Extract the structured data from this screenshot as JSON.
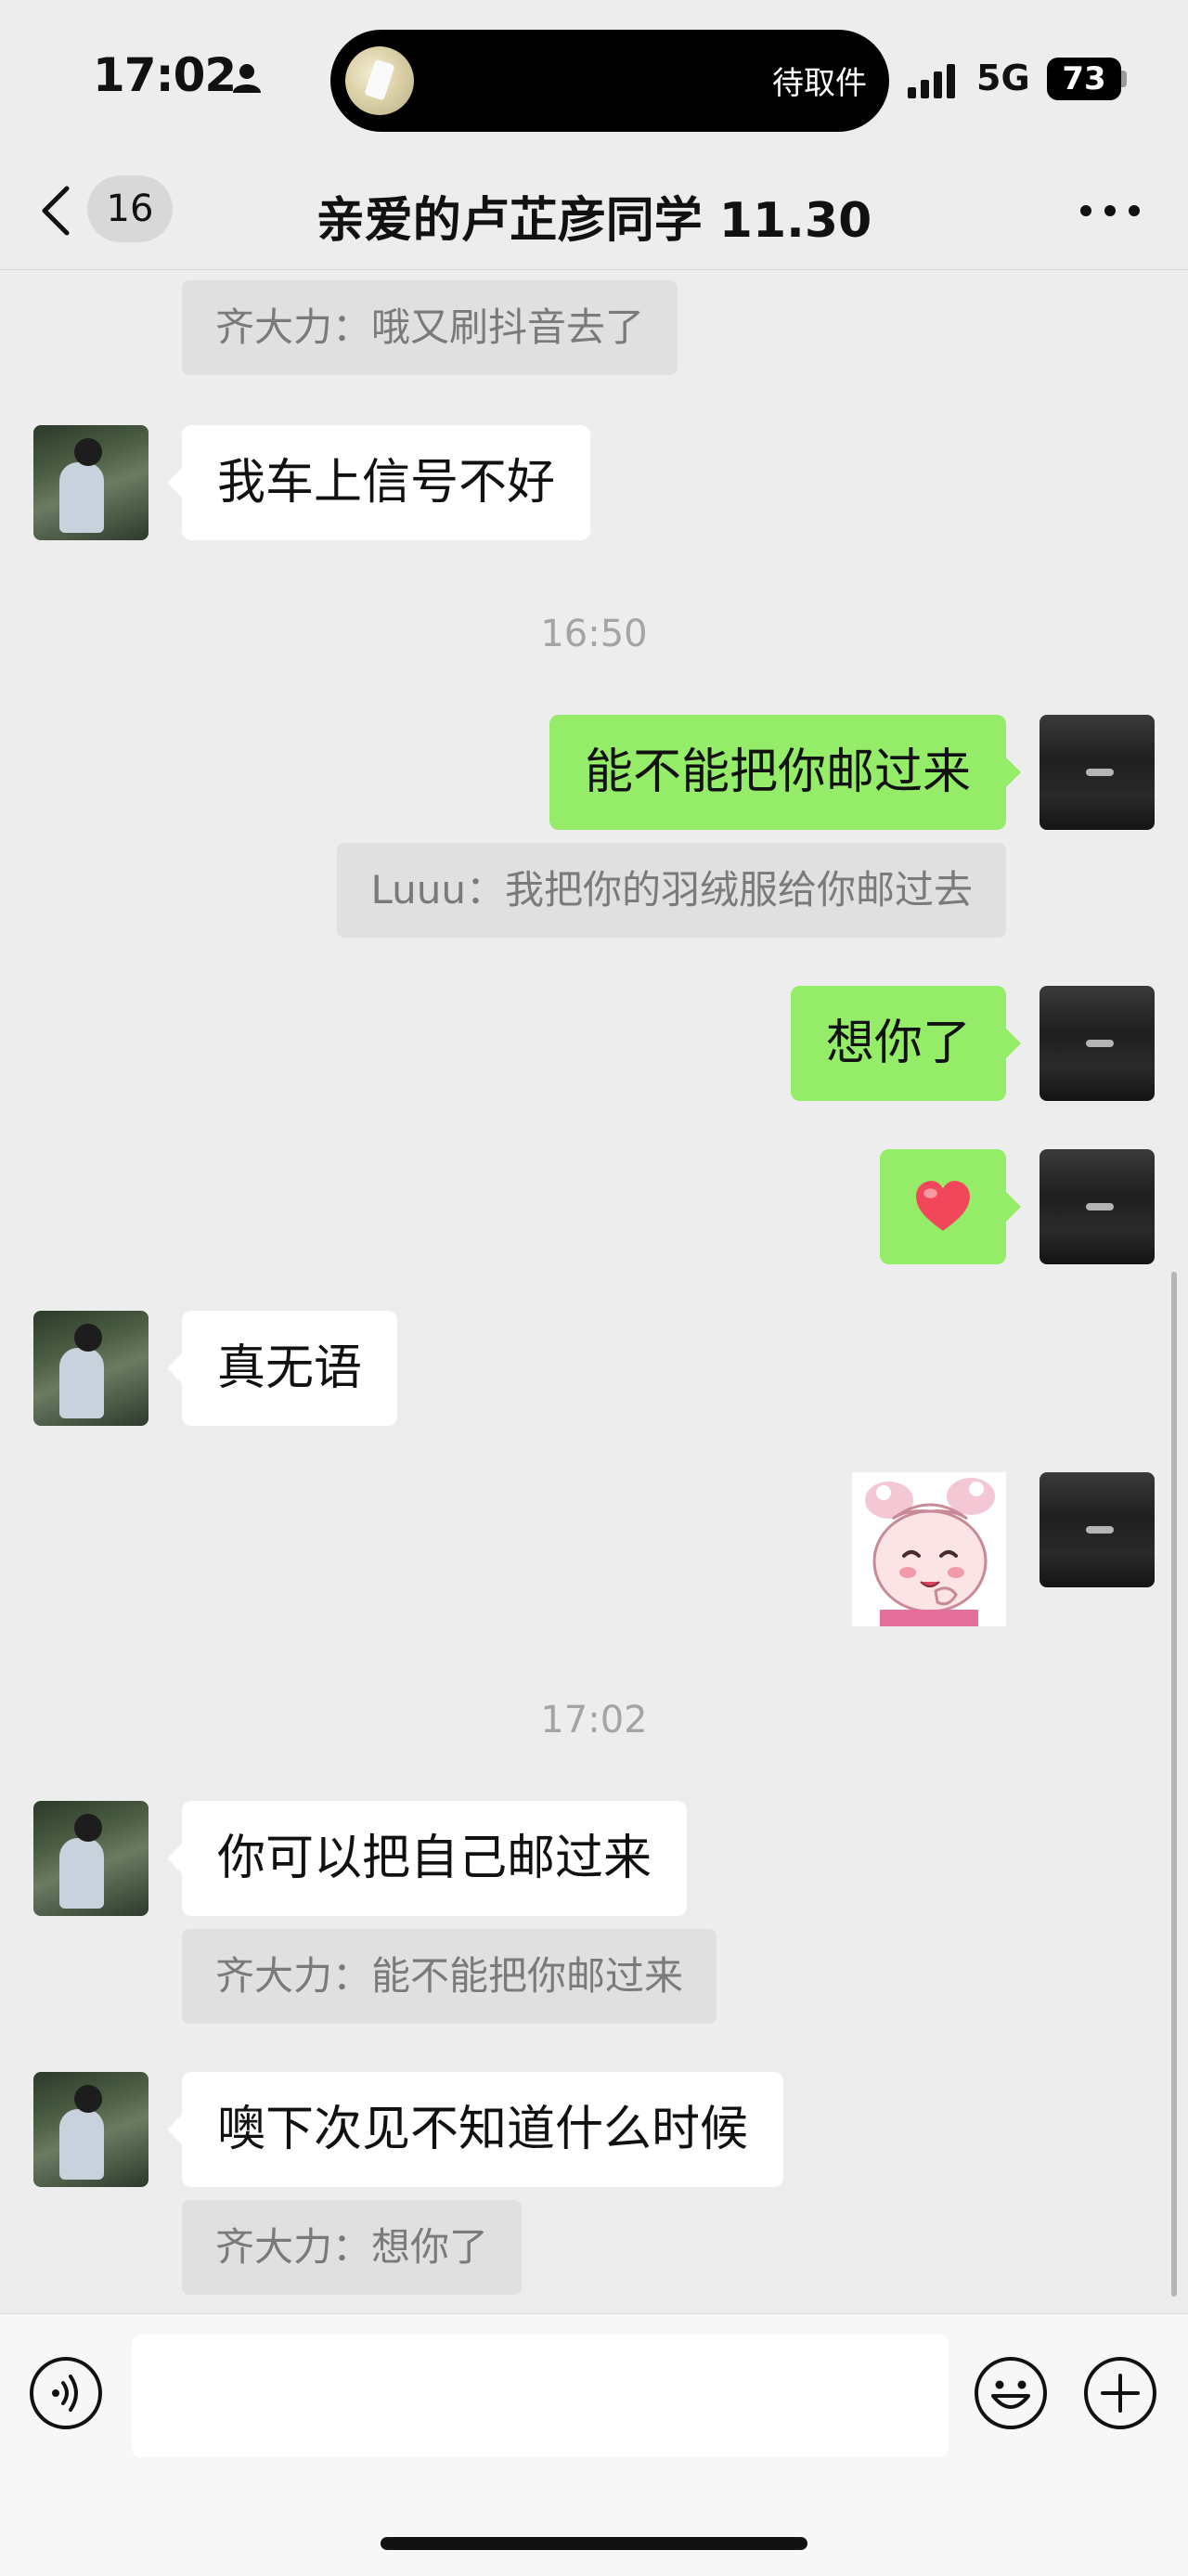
{
  "status_bar": {
    "time": "17:02",
    "island_text": "待取件",
    "network": "5G",
    "battery": "73"
  },
  "nav": {
    "unread_count": "16",
    "title": "亲爱的卢芷彦同学 11.30"
  },
  "messages": [
    {
      "type": "quote",
      "text": "齐大力：哦又刷抖音去了"
    },
    {
      "type": "text",
      "side": "other",
      "text": "我车上信号不好"
    },
    {
      "type": "time",
      "text": "16:50"
    },
    {
      "type": "text",
      "side": "self",
      "text": "能不能把你邮过来"
    },
    {
      "type": "quote",
      "text": "Luuu：我把你的羽绒服给你邮过去"
    },
    {
      "type": "text",
      "side": "self",
      "text": "想你了"
    },
    {
      "type": "emoji",
      "side": "self",
      "icon": "heart-icon"
    },
    {
      "type": "text",
      "side": "other",
      "text": "真无语"
    },
    {
      "type": "sticker",
      "side": "self",
      "icon": "pleasant-goat-sticker"
    },
    {
      "type": "time",
      "text": "17:02"
    },
    {
      "type": "text",
      "side": "other",
      "text": "你可以把自己邮过来"
    },
    {
      "type": "quote",
      "text": "齐大力：能不能把你邮过来"
    },
    {
      "type": "text",
      "side": "other",
      "text": "噢下次见不知道什么时候"
    },
    {
      "type": "quote",
      "text": "齐大力：想你了"
    }
  ],
  "input_bar": {
    "message_value": "",
    "icons": [
      "voice-icon",
      "emoji-icon",
      "plus-icon"
    ]
  },
  "colors": {
    "background": "#ededed",
    "self_bubble": "#95ec69",
    "other_bubble": "#ffffff",
    "quote_bg": "#e0e0e0"
  }
}
